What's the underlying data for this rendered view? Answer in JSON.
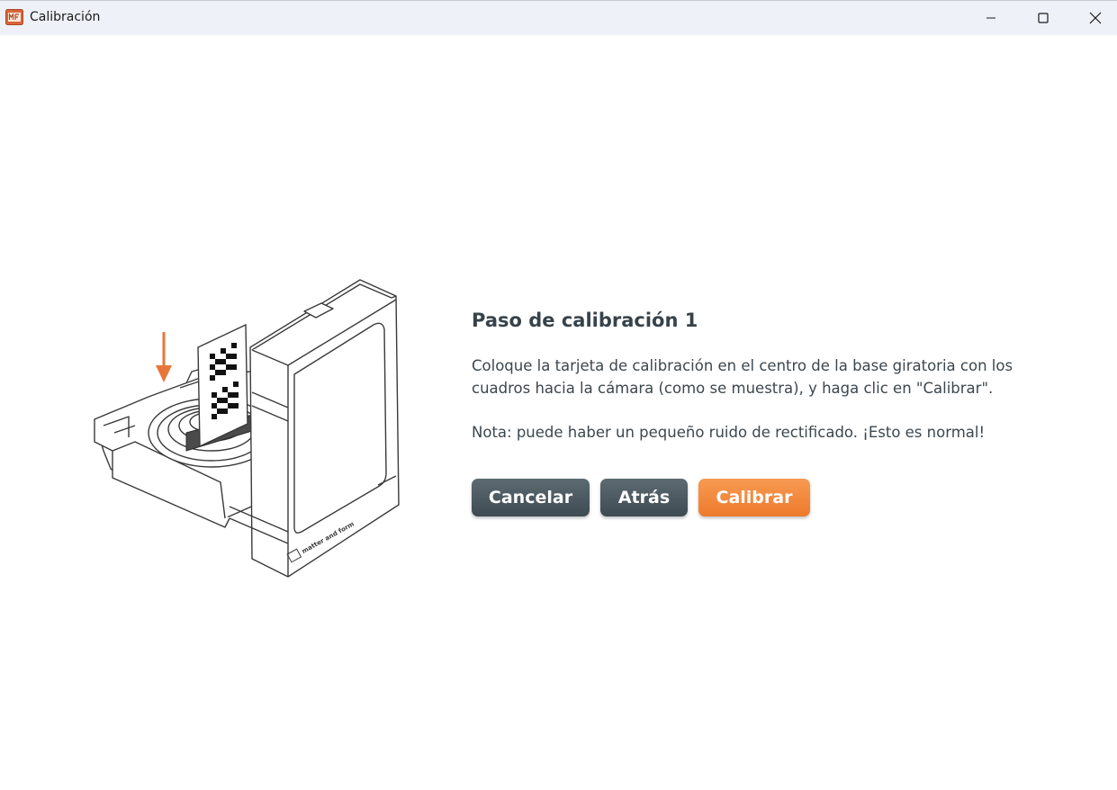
{
  "window": {
    "title": "Calibración",
    "icon": "matter-and-form-app-icon"
  },
  "controls": {
    "minimize_icon": "minimize-icon",
    "maximize_icon": "maximize-icon",
    "close_icon": "close-icon"
  },
  "illustration": {
    "brand_text": "matter and form",
    "arrow_color": "#e8763a"
  },
  "step": {
    "title": "Paso de calibración 1",
    "instructions": "Coloque la tarjeta de calibración en el centro de la base giratoria con los cuadros hacia la cámara (como se muestra), y haga clic en \"Calibrar\".",
    "note": "Nota: puede haber un pequeño ruido de rectificado. ¡Esto es normal!"
  },
  "buttons": {
    "cancel": "Cancelar",
    "back": "Atrás",
    "calibrate": "Calibrar"
  },
  "colors": {
    "accent": "#ee7a2c",
    "dark_button": "#4a575e",
    "text": "#3c474e"
  }
}
